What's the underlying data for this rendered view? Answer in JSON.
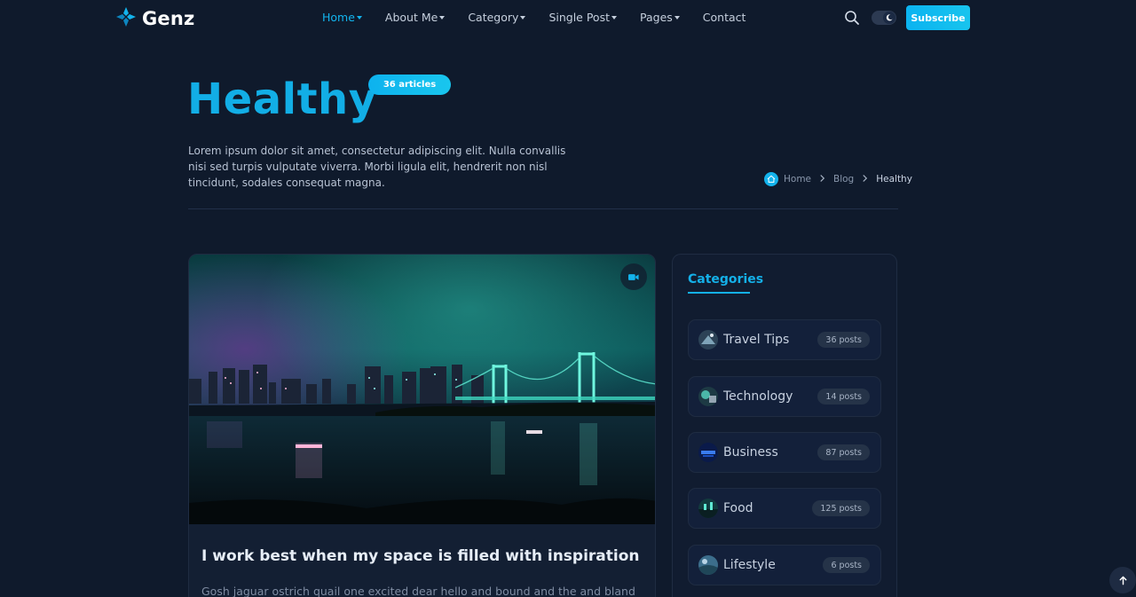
{
  "brand": {
    "name": "Genz"
  },
  "nav": {
    "items": [
      {
        "label": "Home",
        "dropdown": true,
        "active": true
      },
      {
        "label": "About Me",
        "dropdown": true
      },
      {
        "label": "Category",
        "dropdown": true
      },
      {
        "label": "Single Post",
        "dropdown": true
      },
      {
        "label": "Pages",
        "dropdown": true
      },
      {
        "label": "Contact",
        "dropdown": false
      }
    ],
    "subscribe_label": "Subscribe"
  },
  "header": {
    "title": "Healthy",
    "article_count": "36 articles",
    "description": "Lorem ipsum dolor sit amet, consectetur adipiscing elit. Nulla convallis nisi sed turpis vulputate viverra. Morbi ligula elit, hendrerit non nisl tincidunt, sodales consequat magna."
  },
  "breadcrumb": {
    "home": "Home",
    "blog": "Blog",
    "current": "Healthy"
  },
  "post": {
    "title": "I work best when my space is filled with inspiration",
    "excerpt": "Gosh jaguar ostrich quail one excited dear hello and bound and the and bland"
  },
  "sidebar": {
    "title": "Categories",
    "categories": [
      {
        "label": "Travel Tips",
        "count": "36 posts"
      },
      {
        "label": "Technology",
        "count": "14 posts"
      },
      {
        "label": "Business",
        "count": "87 posts"
      },
      {
        "label": "Food",
        "count": "125 posts"
      },
      {
        "label": "Lifestyle",
        "count": "6 posts"
      }
    ]
  },
  "colors": {
    "accent": "#12b4ee",
    "background": "#0f1a2c",
    "card": "#131f33"
  },
  "icons": [
    "logo-icon",
    "search-icon",
    "moon-icon",
    "home-icon",
    "chevron-right-icon",
    "video-icon",
    "arrow-up-icon"
  ]
}
